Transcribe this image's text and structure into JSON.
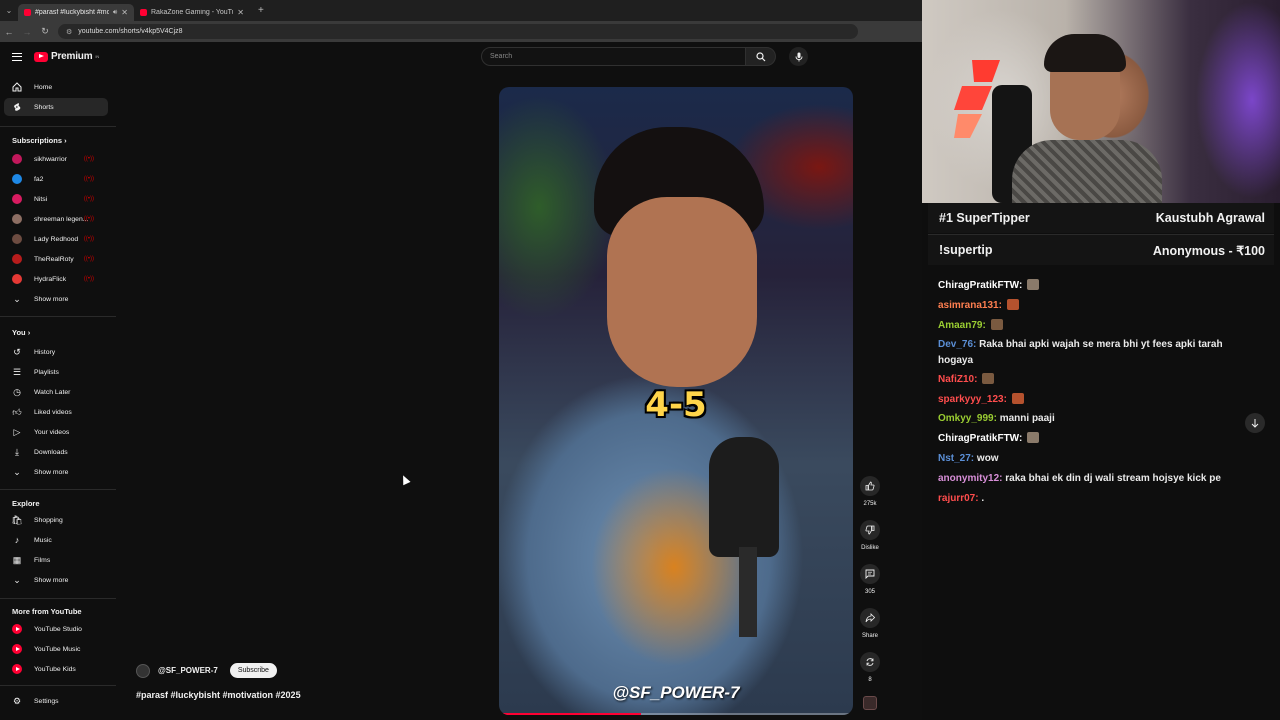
{
  "browser": {
    "tabs": [
      {
        "title": "#parasf #luckybisht #motivation",
        "active": true
      },
      {
        "title": "RakaZone Gaming - YouTube",
        "active": false
      }
    ],
    "url": "youtube.com/shorts/v4kp5V4Cjz8"
  },
  "header": {
    "logo_text": "Premium",
    "logo_sup": "IN",
    "search_placeholder": "Search"
  },
  "sidebar": {
    "main": [
      {
        "label": "Home",
        "icon": "home-icon"
      },
      {
        "label": "Shorts",
        "icon": "shorts-icon",
        "active": true
      }
    ],
    "subscriptions_title": "Subscriptions",
    "subscriptions": [
      {
        "label": "sikhwarrior",
        "color": "#c2185b"
      },
      {
        "label": "fa2",
        "color": "#1e88e5"
      },
      {
        "label": "Nitsi",
        "color": "#d81b60"
      },
      {
        "label": "shreeman legen...",
        "color": "#8d6e63"
      },
      {
        "label": "Lady Redhood",
        "color": "#6d4c41"
      },
      {
        "label": "TheRealRoty",
        "color": "#b71c1c"
      },
      {
        "label": "HydraFlick",
        "color": "#e53935"
      }
    ],
    "show_more": "Show more",
    "you_title": "You",
    "you": [
      {
        "label": "History",
        "icon": "history-icon"
      },
      {
        "label": "Playlists",
        "icon": "playlists-icon"
      },
      {
        "label": "Watch Later",
        "icon": "watch-later-icon"
      },
      {
        "label": "Liked videos",
        "icon": "like-icon"
      },
      {
        "label": "Your videos",
        "icon": "your-videos-icon"
      },
      {
        "label": "Downloads",
        "icon": "download-icon"
      }
    ],
    "explore_title": "Explore",
    "explore": [
      {
        "label": "Shopping",
        "icon": "shopping-icon"
      },
      {
        "label": "Music",
        "icon": "music-icon"
      },
      {
        "label": "Films",
        "icon": "films-icon"
      }
    ],
    "more_title": "More from YouTube",
    "more": [
      {
        "label": "YouTube Studio"
      },
      {
        "label": "YouTube Music"
      },
      {
        "label": "YouTube Kids"
      }
    ],
    "settings": "Settings"
  },
  "video": {
    "caption": "4-5",
    "watermark": "@SF_POWER-7",
    "progress": 0.4,
    "channel": "@SF_POWER-7",
    "subscribe": "Subscribe",
    "description": "#parasf #luckybisht #motivation #2025"
  },
  "actions": {
    "likes": "275k",
    "dislike": "Dislike",
    "comments": "305",
    "share": "Share",
    "remix": "8"
  },
  "stream": {
    "banners": [
      {
        "left": "#1 SuperTipper",
        "right": "Kaustubh Agrawal"
      },
      {
        "left": "!supertip",
        "right": "Anonymous - ₹100"
      }
    ],
    "chat": [
      {
        "user": "ChiragPratikFTW:",
        "color": "#ffffff",
        "text": "",
        "emote": "#8a7a6a"
      },
      {
        "user": "asimrana131:",
        "color": "#ff7f50",
        "text": "",
        "emote": "#b5522e"
      },
      {
        "user": "Amaan79:",
        "color": "#9acd32",
        "text": "",
        "emote": "#7a5a40"
      },
      {
        "user": "Dev_76:",
        "color": "#5b8fd6",
        "text": "Raka bhai apki wajah se mera bhi yt fees apki tarah hogaya",
        "emote": ""
      },
      {
        "user": "NafiZ10:",
        "color": "#ff4d4d",
        "text": "",
        "emote": "#7a5a40"
      },
      {
        "user": "sparkyyy_123:",
        "color": "#ff4d4d",
        "text": "",
        "emote": "#b5522e"
      },
      {
        "user": "Omkyy_999:",
        "color": "#9acd32",
        "text": "manni paaji",
        "emote": ""
      },
      {
        "user": "ChiragPratikFTW:",
        "color": "#ffffff",
        "text": "",
        "emote": "#8a7a6a"
      },
      {
        "user": "Nst_27:",
        "color": "#5b8fd6",
        "text": "wow",
        "emote": ""
      },
      {
        "user": "anonymity12:",
        "color": "#d88fd8",
        "text": "raka bhai ek din dj wali stream hojsye kick pe",
        "emote": ""
      },
      {
        "user": "rajurr07:",
        "color": "#ff4d4d",
        "text": ".",
        "emote": ""
      }
    ]
  },
  "colors": {
    "accent": "#ff0033",
    "background": "#0f0f0f"
  }
}
